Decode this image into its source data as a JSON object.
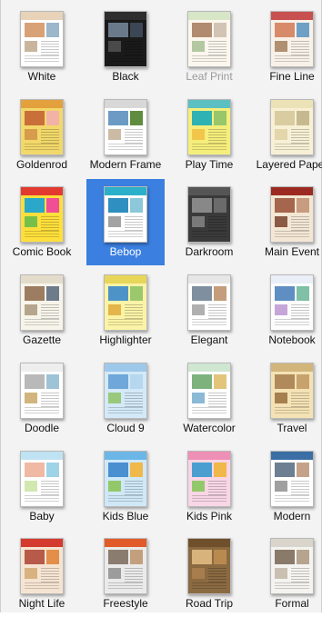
{
  "window": {
    "themes": [
      {
        "id": "white",
        "label": "White",
        "bg": "#ffffff",
        "hdr": "#e8d2b8",
        "p1": "#d9a276",
        "p2": "#9bb7c9",
        "p3": "#c8b59c",
        "state": "normal"
      },
      {
        "id": "black",
        "label": "Black",
        "bg": "#1a1a1a",
        "hdr": "#2e2e2e",
        "p1": "#6a7a8a",
        "p2": "#3b4754",
        "p3": "#4a4a4a",
        "state": "normal"
      },
      {
        "id": "leaf-print",
        "label": "Leaf Print",
        "bg": "#fbf7ee",
        "hdr": "#d8e6c8",
        "p1": "#b08b6f",
        "p2": "#d2c4b4",
        "p3": "#b3c8a0",
        "state": "disabled"
      },
      {
        "id": "fine-line",
        "label": "Fine Line",
        "bg": "#f7f1e8",
        "hdr": "#c85050",
        "p1": "#d88b6a",
        "p2": "#6e9fc5",
        "p3": "#b09070",
        "state": "normal"
      },
      {
        "id": "goldenrod",
        "label": "Goldenrod",
        "bg": "#f2d86a",
        "hdr": "#e2a13c",
        "p1": "#c9703a",
        "p2": "#f3b2a7",
        "p3": "#d79b4c",
        "state": "normal"
      },
      {
        "id": "modern-frame",
        "label": "Modern Frame",
        "bg": "#ffffff",
        "hdr": "#d8d8d8",
        "p1": "#6d9ac5",
        "p2": "#5f8c3f",
        "p3": "#ccbba4",
        "state": "normal"
      },
      {
        "id": "play-time",
        "label": "Play Time",
        "bg": "#f5ee7c",
        "hdr": "#5cc0c2",
        "p1": "#2fb2b2",
        "p2": "#97c76a",
        "p3": "#f2c64a",
        "state": "normal"
      },
      {
        "id": "layered-paper",
        "label": "Layered Paper",
        "bg": "#f7f0d5",
        "hdr": "#ece2b7",
        "p1": "#d9cca0",
        "p2": "#c7b98f",
        "p3": "#e3d6ab",
        "state": "normal"
      },
      {
        "id": "comic-book",
        "label": "Comic Book",
        "bg": "#ffdf3b",
        "hdr": "#e23a2f",
        "p1": "#2aa7c9",
        "p2": "#f04f96",
        "p3": "#76c04a",
        "state": "normal"
      },
      {
        "id": "bebop",
        "label": "Bebop",
        "bg": "#ffffff",
        "hdr": "#2cb0c9",
        "p1": "#2f8fbf",
        "p2": "#8cc8d9",
        "p3": "#a3a3a3",
        "state": "selected"
      },
      {
        "id": "darkroom",
        "label": "Darkroom",
        "bg": "#3a3a3a",
        "hdr": "#555555",
        "p1": "#888888",
        "p2": "#6b6b6b",
        "p3": "#7a7a7a",
        "state": "normal"
      },
      {
        "id": "main-event",
        "label": "Main Event",
        "bg": "#f3e7d4",
        "hdr": "#9b2b22",
        "p1": "#a5664d",
        "p2": "#c79c80",
        "p3": "#8b5a44",
        "state": "normal"
      },
      {
        "id": "gazette",
        "label": "Gazette",
        "bg": "#f7f4ea",
        "hdr": "#e3dccb",
        "p1": "#9c7d62",
        "p2": "#6d7b8b",
        "p3": "#b6a58d",
        "state": "normal"
      },
      {
        "id": "highlighter",
        "label": "Highlighter",
        "bg": "#fbf3a6",
        "hdr": "#e7d65a",
        "p1": "#4e93c7",
        "p2": "#9bc86c",
        "p3": "#e4b54a",
        "state": "normal"
      },
      {
        "id": "elegant",
        "label": "Elegant",
        "bg": "#ffffff",
        "hdr": "#e6e6e6",
        "p1": "#7f8fa0",
        "p2": "#c39d7c",
        "p3": "#b0b0b0",
        "state": "normal"
      },
      {
        "id": "notebook",
        "label": "Notebook",
        "bg": "#fdfdfd",
        "hdr": "#e9eef7",
        "p1": "#5f8fc2",
        "p2": "#7fc0a6",
        "p3": "#c6a6d9",
        "state": "normal"
      },
      {
        "id": "doodle",
        "label": "Doodle",
        "bg": "#ffffff",
        "hdr": "#eeeeee",
        "p1": "#b9b9b9",
        "p2": "#9fc3d6",
        "p3": "#d1b57c",
        "state": "normal"
      },
      {
        "id": "cloud-9",
        "label": "Cloud 9",
        "bg": "#d3e9f7",
        "hdr": "#9ec8ea",
        "p1": "#6fa7d8",
        "p2": "#b7d7ef",
        "p3": "#98c87b",
        "state": "normal"
      },
      {
        "id": "watercolor",
        "label": "Watercolor",
        "bg": "#ffffff",
        "hdr": "#cfe6d1",
        "p1": "#7db27d",
        "p2": "#e2c47b",
        "p3": "#8bb9d6",
        "state": "normal"
      },
      {
        "id": "travel",
        "label": "Travel",
        "bg": "#f4e2b4",
        "hdr": "#d2b57b",
        "p1": "#b08a5a",
        "p2": "#c7a26c",
        "p3": "#a57f4e",
        "state": "normal"
      },
      {
        "id": "baby",
        "label": "Baby",
        "bg": "#ffffff",
        "hdr": "#bfe3f2",
        "p1": "#f0b9a3",
        "p2": "#9fd3e6",
        "p3": "#d2e8b1",
        "state": "normal"
      },
      {
        "id": "kids-blue",
        "label": "Kids Blue",
        "bg": "#cfe8f8",
        "hdr": "#6bb6e6",
        "p1": "#4a8fd0",
        "p2": "#f0b84a",
        "p3": "#93c86a",
        "state": "normal"
      },
      {
        "id": "kids-pink",
        "label": "Kids Pink",
        "bg": "#f8d6e5",
        "hdr": "#ee8fb6",
        "p1": "#4a9fd0",
        "p2": "#f0b84a",
        "p3": "#93c86a",
        "state": "normal"
      },
      {
        "id": "modern",
        "label": "Modern",
        "bg": "#ffffff",
        "hdr": "#3a6ea5",
        "p1": "#6d7f92",
        "p2": "#c4a28a",
        "p3": "#9f9f9f",
        "state": "normal"
      },
      {
        "id": "night-life",
        "label": "Night Life",
        "bg": "#f6e4d2",
        "hdr": "#d43a2e",
        "p1": "#b85a4a",
        "p2": "#e38f4a",
        "p3": "#d8b280",
        "state": "normal"
      },
      {
        "id": "freestyle",
        "label": "Freestyle",
        "bg": "#eaeaea",
        "hdr": "#e05a2a",
        "p1": "#8a7d70",
        "p2": "#c2a07e",
        "p3": "#9c9c9c",
        "state": "normal"
      },
      {
        "id": "road-trip",
        "label": "Road Trip",
        "bg": "#8b6a42",
        "hdr": "#6f4f2c",
        "p1": "#d8b47c",
        "p2": "#b98a50",
        "p3": "#a87d4e",
        "state": "normal"
      },
      {
        "id": "formal",
        "label": "Formal",
        "bg": "#f5f3ef",
        "hdr": "#d9d5cc",
        "p1": "#8a7a6a",
        "p2": "#b7a48f",
        "p3": "#c9c0b2",
        "state": "normal"
      }
    ]
  }
}
